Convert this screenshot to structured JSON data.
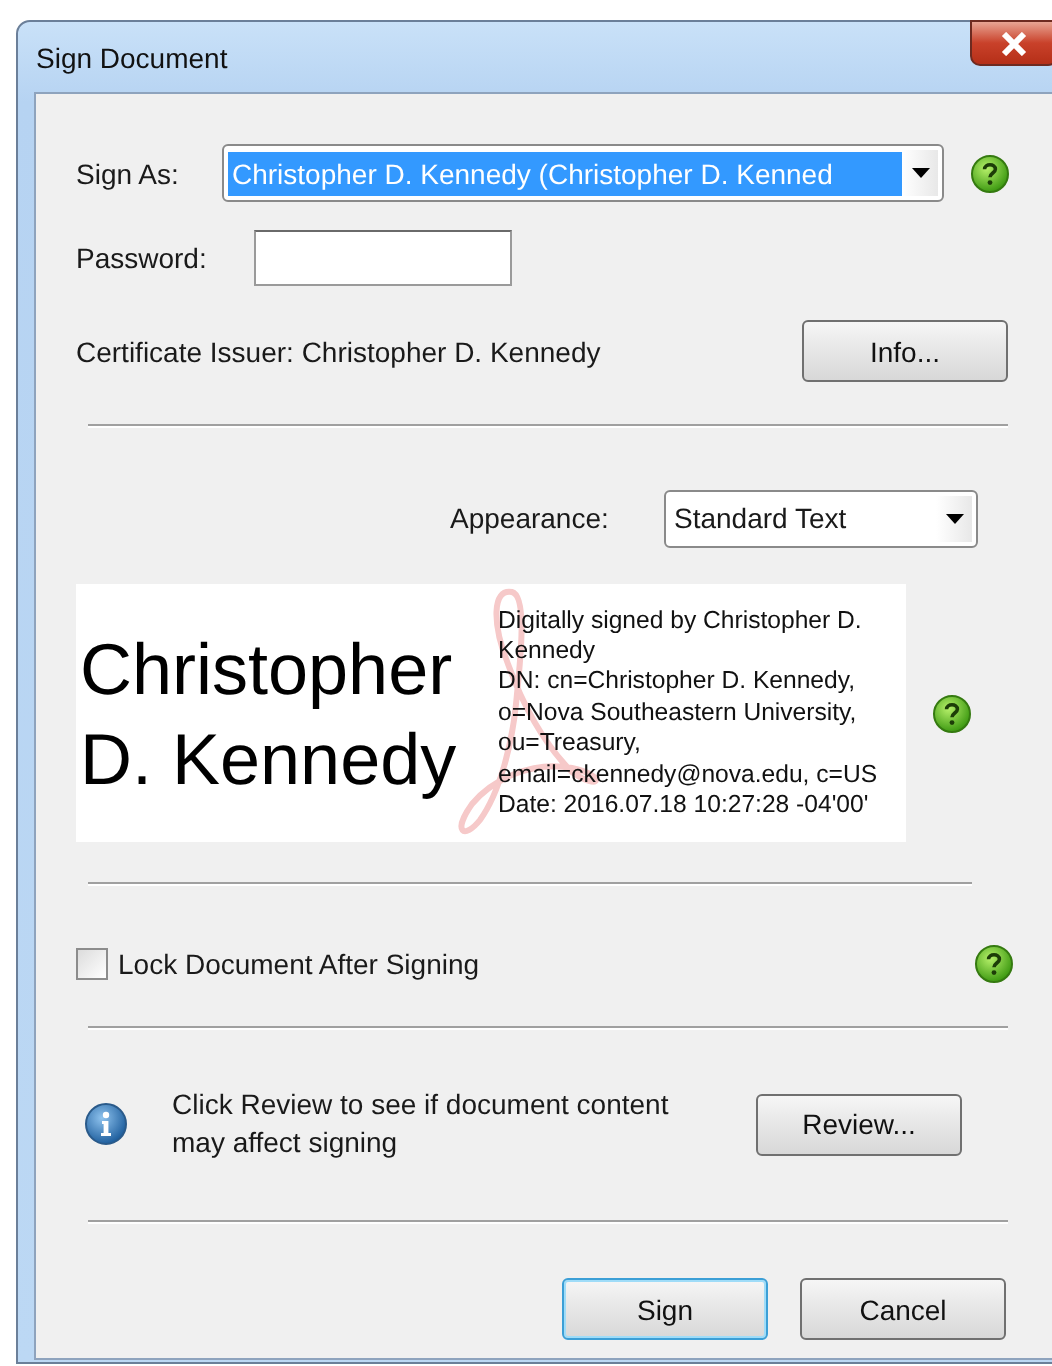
{
  "window": {
    "title": "Sign Document"
  },
  "sign_as": {
    "label": "Sign As:",
    "value": "Christopher D. Kennedy (Christopher D. Kenned",
    "highlighted": true
  },
  "password": {
    "label": "Password:"
  },
  "certificate_issuer": "Certificate Issuer: Christopher D. Kennedy",
  "info_button": {
    "label": "Info..."
  },
  "appearance": {
    "label": "Appearance:",
    "value": "Standard Text"
  },
  "preview": {
    "name_lines": [
      "Christopher",
      "D. Kennedy"
    ],
    "details": [
      "Digitally signed by Christopher D.",
      "Kennedy",
      "DN: cn=Christopher D. Kennedy,",
      "o=Nova Southeastern University,",
      "ou=Treasury,",
      "email=ckennedy@nova.edu, c=US",
      "Date: 2016.07.18 10:27:28 -04'00'"
    ]
  },
  "lock": {
    "label": "Lock Document After Signing",
    "checked": false
  },
  "review": {
    "message": "Click Review to see if document content may affect signing",
    "button": {
      "label": "Review..."
    }
  },
  "buttons": [
    {
      "label": "Sign",
      "default": true
    },
    {
      "label": "Cancel",
      "default": false
    }
  ]
}
